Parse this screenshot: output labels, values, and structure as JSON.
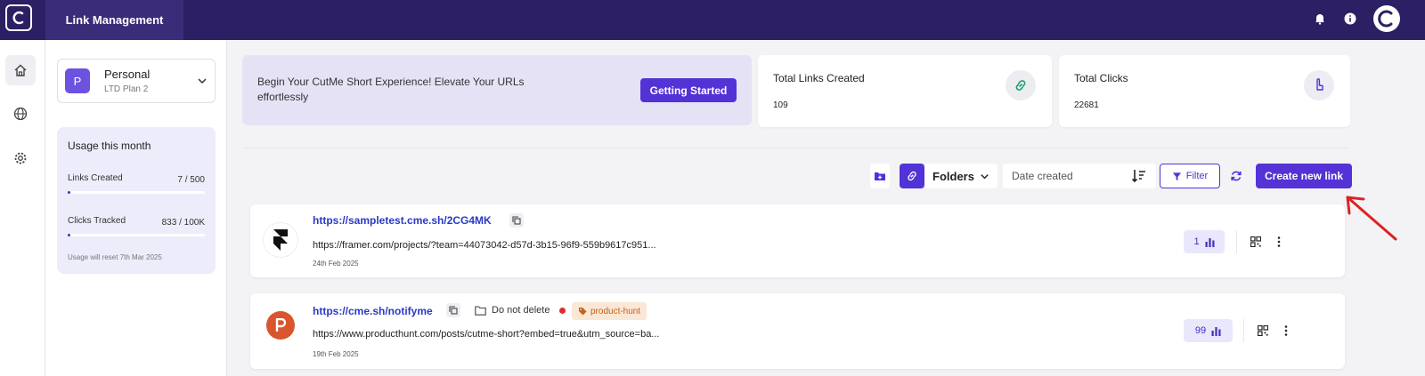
{
  "header": {
    "title": "Link Management",
    "colors": {
      "bar": "#2c1f63",
      "accent": "#5332d6"
    },
    "icons": [
      "app-logo-icon",
      "bell-icon",
      "info-icon",
      "profile-avatar"
    ]
  },
  "rail": {
    "items": [
      "home-icon",
      "globe-icon",
      "gear-icon"
    ]
  },
  "workspace": {
    "initial": "P",
    "name": "Personal",
    "plan": "LTD Plan 2"
  },
  "usage": {
    "title": "Usage this month",
    "links_label": "Links Created",
    "links_value": "7 / 500",
    "links_fraction": 0.014,
    "clicks_label": "Clicks Tracked",
    "clicks_value": "833 / 100K",
    "clicks_fraction": 0.008,
    "reset_note": "Usage will reset 7th Mar 2025"
  },
  "banner": {
    "text": "Begin Your CutMe Short Experience! Elevate Your URLs effortlessly",
    "button": "Getting Started"
  },
  "stats": [
    {
      "title": "Total Links Created",
      "value": "109",
      "icon": "link-icon"
    },
    {
      "title": "Total Clicks",
      "value": "22681",
      "icon": "pointer-icon"
    }
  ],
  "toolbar": {
    "folders_label": "Folders",
    "sort_label": "Date created",
    "filter_label": "Filter",
    "create_label": "Create new link"
  },
  "links": [
    {
      "short_url": "https://sampletest.cme.sh/2CG4MK",
      "long_url": "https://framer.com/projects/?team=44073042-d57d-3b15-96f9-559b9617c951...",
      "date": "24th Feb 2025",
      "clicks": "1",
      "logo": "framer-logo"
    },
    {
      "short_url": "https://cme.sh/notifyme",
      "long_url": "https://www.producthunt.com/posts/cutme-short?embed=true&utm_source=ba...",
      "date": "19th Feb 2025",
      "clicks": "99",
      "folder": "Do not delete",
      "tag": "product-hunt",
      "logo": "producthunt-logo"
    }
  ]
}
